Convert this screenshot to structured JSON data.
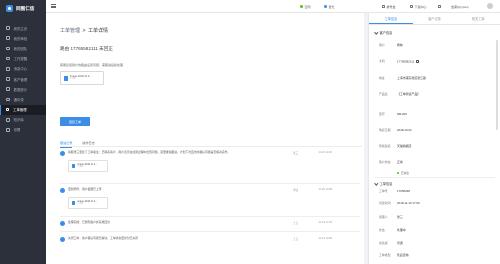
{
  "app": {
    "name": "同图仁信"
  },
  "sidebar": {
    "items": [
      {
        "label": "我的主页",
        "icon": "home-icon"
      },
      {
        "label": "我的审批",
        "icon": "check-icon"
      },
      {
        "label": "我的团队",
        "icon": "team-icon"
      },
      {
        "label": "工作提醒",
        "icon": "bell-icon"
      },
      {
        "label": "消息中心",
        "icon": "message-icon"
      },
      {
        "label": "客户管理",
        "icon": "customer-icon"
      },
      {
        "label": "数据统计",
        "icon": "chart-icon"
      },
      {
        "label": "通讯录",
        "icon": "contacts-icon"
      },
      {
        "label": "工单管理",
        "icon": "ticket-icon",
        "active": true
      },
      {
        "label": "知识库",
        "icon": "book-icon"
      },
      {
        "label": "设置",
        "icon": "gear-icon"
      }
    ]
  },
  "topbar": {
    "status_idle": "空闲",
    "status_online": "置忙",
    "dialpad": "拨号盘",
    "download": "下载中心",
    "user": "坐席QQ-(lan)",
    "colors": {
      "idle": "#52c41a",
      "online": "#3a8ee6"
    }
  },
  "breadcrumb": {
    "parent": "工单管理",
    "sep": ">",
    "current": "工单详情"
  },
  "ticket": {
    "title": "路由 17765582111 未回正",
    "desc": "客服反馈用户的路由设置问题，需跟进后续处理",
    "attachment": {
      "name": "image-2018.11.2...",
      "size": "17KB"
    },
    "reply_button": "回复工单"
  },
  "subtabs": {
    "log": "跟进记录",
    "history": "操作日志"
  },
  "logs": [
    {
      "text": "客服张三更新了工单备注：已联系客户，用户表示在使用过程中出现问题，需要继续跟进，计划下次回访时确认问题是否解决完毕。",
      "by": "张三",
      "time": "11-20 14:02"
    },
    {
      "text": "更新附件：用户截图已上传",
      "by": "李四",
      "time": "11-20 14:08"
    },
    {
      "text": "处理完成：已通知客户并完成回访",
      "by": "王五",
      "time": "11-23 17:03"
    },
    {
      "text": "关闭工单：客户确认问题已解决，工单状态更新为已关闭",
      "by": "王五",
      "time": "11-24 10:00"
    }
  ],
  "log_attachments": [
    {
      "name": "image-2018.11.2...",
      "size": "17KB"
    },
    {
      "name": "image-2018.11.2...",
      "size": "17KB"
    }
  ],
  "rpanel": {
    "tabs": [
      "工单信息",
      "客户记录",
      "相关工单"
    ],
    "customer_title": "客户信息",
    "customer": [
      {
        "k": "客户",
        "v": "杨林"
      },
      {
        "k": "手机",
        "v": "17765582111"
      },
      {
        "k": "地址",
        "v": "上海市浦东新区张江路"
      },
      {
        "k": "产品名",
        "v": "【工单测试产品】"
      },
      {
        "k": "型号",
        "v": "NB-200"
      },
      {
        "k": "购买日期",
        "v": "2018-10-01"
      },
      {
        "k": "所属渠道",
        "v": "天猫旗舰店"
      },
      {
        "k": "客户状态",
        "v": "正常"
      }
    ],
    "favorite": "已关注",
    "ticket_title": "工单信息",
    "ticket": [
      {
        "k": "工单号",
        "v": "17655298"
      },
      {
        "k": "创建时间",
        "v": "2018-11-19 17:00"
      },
      {
        "k": "受理人",
        "v": "张三"
      },
      {
        "k": "状态",
        "v": "处理中"
      },
      {
        "k": "优先级",
        "v": "普通"
      },
      {
        "k": "工单类型",
        "v": "售后咨询"
      }
    ]
  }
}
